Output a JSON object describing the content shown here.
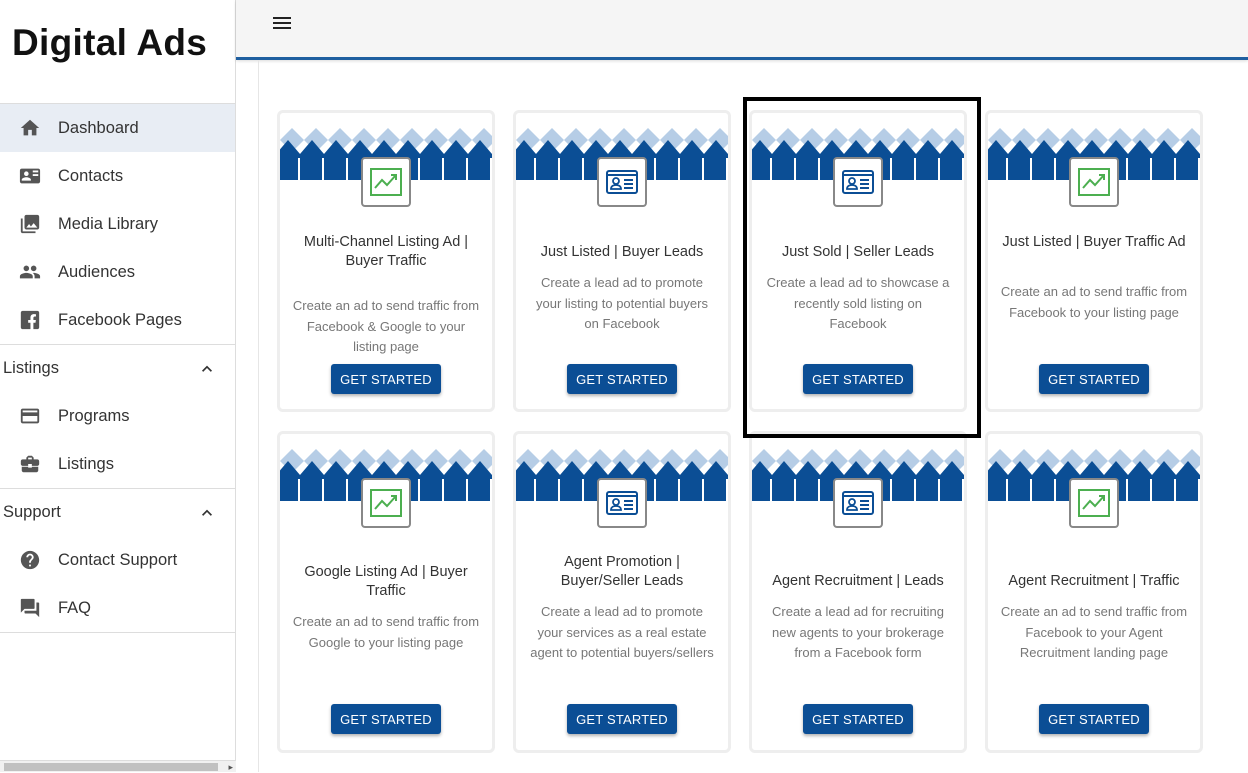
{
  "brand": "Digital Ads",
  "nav": {
    "main": [
      {
        "label": "Dashboard",
        "icon": "home-icon"
      },
      {
        "label": "Contacts",
        "icon": "contact-card-icon"
      },
      {
        "label": "Media Library",
        "icon": "photo-library-icon"
      },
      {
        "label": "Audiences",
        "icon": "people-icon"
      },
      {
        "label": "Facebook Pages",
        "icon": "facebook-icon"
      }
    ],
    "listings_header": "Listings",
    "listings": [
      {
        "label": "Programs",
        "icon": "credit-card-icon"
      },
      {
        "label": "Listings",
        "icon": "briefcase-icon"
      }
    ],
    "support_header": "Support",
    "support": [
      {
        "label": "Contact Support",
        "icon": "help-circle-icon"
      },
      {
        "label": "FAQ",
        "icon": "forum-icon"
      }
    ]
  },
  "cards": [
    {
      "title": "Multi-Channel Listing Ad | Buyer Traffic",
      "desc": "Create an ad to send traffic from Facebook & Google to your listing page",
      "icon": "trending-up-icon",
      "button": "GET STARTED"
    },
    {
      "title": "Just Listed | Buyer Leads",
      "desc": "Create a lead ad to promote your listing to potential buyers on Facebook",
      "icon": "id-card-icon",
      "button": "GET STARTED"
    },
    {
      "title": "Just Sold | Seller Leads",
      "desc": "Create a lead ad to showcase a recently sold listing on Facebook",
      "icon": "id-card-icon",
      "button": "GET STARTED"
    },
    {
      "title": "Just Listed | Buyer Traffic Ad",
      "desc": "Create an ad to send traffic from Facebook to your listing page",
      "icon": "trending-up-icon",
      "button": "GET STARTED"
    },
    {
      "title": "Google Listing Ad | Buyer Traffic",
      "desc": "Create an ad to send traffic from Google to your listing page",
      "icon": "trending-up-icon",
      "button": "GET STARTED"
    },
    {
      "title": "Agent Promotion | Buyer/Seller Leads",
      "desc": "Create a lead ad to promote your services as a real estate agent to potential buyers/sellers",
      "icon": "id-card-icon",
      "button": "GET STARTED"
    },
    {
      "title": "Agent Recruitment | Leads",
      "desc": "Create a lead ad for recruiting new agents to your brokerage from a Facebook form",
      "icon": "id-card-icon",
      "button": "GET STARTED"
    },
    {
      "title": "Agent Recruitment | Traffic",
      "desc": "Create an ad to send traffic from Facebook to your Agent Recruitment landing page",
      "icon": "trending-up-icon",
      "button": "GET STARTED"
    }
  ],
  "colors": {
    "accent": "#0b4e95",
    "banner_dark": "#0b4e95",
    "banner_light": "#b6cde6",
    "trend_green": "#4caf50"
  }
}
